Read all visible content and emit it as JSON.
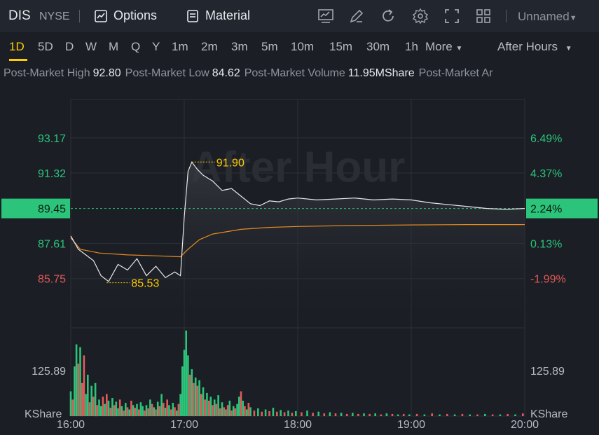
{
  "header": {
    "ticker": "DIS",
    "exchange": "NYSE",
    "options_label": "Options",
    "material_label": "Material",
    "layout_name": "Unnamed",
    "icons": [
      "chart-indicator-icon",
      "draw-icon",
      "refresh-icon",
      "settings-icon",
      "fullscreen-icon",
      "grid-layout-icon"
    ]
  },
  "periods": {
    "items": [
      "1D",
      "5D",
      "D",
      "W",
      "M",
      "Q",
      "Y",
      "1m",
      "2m",
      "3m",
      "5m",
      "10m",
      "15m",
      "30m",
      "1h"
    ],
    "more": "More",
    "active": "1D",
    "session": "After Hours"
  },
  "stats": [
    {
      "label": "Post-Market High",
      "value": "92.80"
    },
    {
      "label": "Post-Market Low",
      "value": "84.62"
    },
    {
      "label": "Post-Market Volume",
      "value": "11.95MShare"
    },
    {
      "label": "Post-Market Ar",
      "value": ""
    }
  ],
  "colors": {
    "up": "#2bc47a",
    "down": "#e25a5a",
    "price_line": "#e8e8e8",
    "avg_line": "#e68a1f",
    "accent": "#ffcc00",
    "current_bg": "#2bc47a"
  },
  "chart_data": {
    "type": "line",
    "watermark": "After Hour",
    "x_ticks": [
      "16:00",
      "17:00",
      "18:00",
      "19:00",
      "20:00"
    ],
    "y_left_ticks": [
      {
        "value": 93.17,
        "label": "93.17",
        "color": "up"
      },
      {
        "value": 91.32,
        "label": "91.32",
        "color": "up"
      },
      {
        "value": 87.61,
        "label": "87.61",
        "color": "up"
      },
      {
        "value": 85.75,
        "label": "85.75",
        "color": "down"
      }
    ],
    "y_right_ticks": [
      {
        "value": 93.17,
        "label": "6.49%",
        "color": "up"
      },
      {
        "value": 91.32,
        "label": "4.37%",
        "color": "up"
      },
      {
        "value": 87.61,
        "label": "0.13%",
        "color": "up"
      },
      {
        "value": 85.75,
        "label": "-1.99%",
        "color": "down"
      }
    ],
    "current": {
      "price": 89.45,
      "price_label": "89.45",
      "pct_label": "2.24%"
    },
    "ylim": [
      83.3,
      95.2
    ],
    "annotations": [
      {
        "time": "16:19",
        "value": 85.53,
        "label": "85.53"
      },
      {
        "time": "17:04",
        "value": 91.9,
        "label": "91.90"
      }
    ],
    "series": [
      {
        "role": "price",
        "times": [
          "16:00",
          "16:04",
          "16:08",
          "16:12",
          "16:16",
          "16:20",
          "16:25",
          "16:30",
          "16:35",
          "16:40",
          "16:45",
          "16:50",
          "16:55",
          "16:58",
          "17:00",
          "17:02",
          "17:04",
          "17:07",
          "17:10",
          "17:15",
          "17:20",
          "17:25",
          "17:30",
          "17:35",
          "17:40",
          "17:45",
          "17:50",
          "17:55",
          "18:00",
          "18:10",
          "18:20",
          "18:30",
          "18:40",
          "18:50",
          "19:00",
          "19:10",
          "19:20",
          "19:30",
          "19:40",
          "19:50",
          "20:00"
        ],
        "values": [
          88.0,
          87.3,
          87.0,
          86.7,
          85.9,
          85.6,
          86.5,
          86.2,
          86.8,
          85.9,
          86.4,
          85.8,
          86.1,
          85.9,
          89.0,
          91.4,
          91.9,
          91.5,
          91.2,
          90.9,
          90.4,
          90.5,
          90.1,
          89.7,
          89.6,
          89.85,
          89.8,
          89.95,
          90.0,
          89.9,
          89.95,
          90.0,
          89.9,
          89.95,
          89.9,
          89.75,
          89.65,
          89.55,
          89.45,
          89.4,
          89.45
        ]
      },
      {
        "role": "average",
        "times": [
          "16:00",
          "16:05",
          "16:15",
          "16:30",
          "16:45",
          "16:58",
          "17:02",
          "17:08",
          "17:15",
          "17:30",
          "17:45",
          "18:00",
          "18:30",
          "19:00",
          "19:30",
          "20:00"
        ],
        "values": [
          87.9,
          87.3,
          87.1,
          87.0,
          86.95,
          86.9,
          87.3,
          87.8,
          88.1,
          88.35,
          88.45,
          88.5,
          88.55,
          88.58,
          88.6,
          88.6
        ]
      }
    ],
    "volume": {
      "axis_label": "125.89",
      "unit": "KShare",
      "max": 160,
      "bars": [
        {
          "time": "16:00",
          "value": 45,
          "dir": "up"
        },
        {
          "time": "16:01",
          "value": 30,
          "dir": "down"
        },
        {
          "time": "16:02",
          "value": 90,
          "dir": "up"
        },
        {
          "time": "16:03",
          "value": 130,
          "dir": "up"
        },
        {
          "time": "16:04",
          "value": 95,
          "dir": "down"
        },
        {
          "time": "16:05",
          "value": 125,
          "dir": "up"
        },
        {
          "time": "16:06",
          "value": 60,
          "dir": "down"
        },
        {
          "time": "16:07",
          "value": 110,
          "dir": "down"
        },
        {
          "time": "16:08",
          "value": 40,
          "dir": "up"
        },
        {
          "time": "16:09",
          "value": 75,
          "dir": "up"
        },
        {
          "time": "16:10",
          "value": 25,
          "dir": "down"
        },
        {
          "time": "16:11",
          "value": 55,
          "dir": "up"
        },
        {
          "time": "16:12",
          "value": 35,
          "dir": "down"
        },
        {
          "time": "16:13",
          "value": 60,
          "dir": "up"
        },
        {
          "time": "16:14",
          "value": 20,
          "dir": "down"
        },
        {
          "time": "16:15",
          "value": 30,
          "dir": "up"
        },
        {
          "time": "16:16",
          "value": 18,
          "dir": "up"
        },
        {
          "time": "16:17",
          "value": 35,
          "dir": "down"
        },
        {
          "time": "16:18",
          "value": 22,
          "dir": "up"
        },
        {
          "time": "16:19",
          "value": 40,
          "dir": "down"
        },
        {
          "time": "16:20",
          "value": 28,
          "dir": "up"
        },
        {
          "time": "16:21",
          "value": 15,
          "dir": "down"
        },
        {
          "time": "16:22",
          "value": 33,
          "dir": "up"
        },
        {
          "time": "16:23",
          "value": 20,
          "dir": "down"
        },
        {
          "time": "16:24",
          "value": 26,
          "dir": "up"
        },
        {
          "time": "16:25",
          "value": 14,
          "dir": "up"
        },
        {
          "time": "16:26",
          "value": 30,
          "dir": "down"
        },
        {
          "time": "16:27",
          "value": 18,
          "dir": "up"
        },
        {
          "time": "16:28",
          "value": 10,
          "dir": "down"
        },
        {
          "time": "16:29",
          "value": 24,
          "dir": "up"
        },
        {
          "time": "16:30",
          "value": 16,
          "dir": "down"
        },
        {
          "time": "16:31",
          "value": 12,
          "dir": "up"
        },
        {
          "time": "16:32",
          "value": 28,
          "dir": "down"
        },
        {
          "time": "16:33",
          "value": 20,
          "dir": "up"
        },
        {
          "time": "16:34",
          "value": 15,
          "dir": "down"
        },
        {
          "time": "16:35",
          "value": 22,
          "dir": "up"
        },
        {
          "time": "16:36",
          "value": 12,
          "dir": "down"
        },
        {
          "time": "16:37",
          "value": 25,
          "dir": "up"
        },
        {
          "time": "16:38",
          "value": 18,
          "dir": "up"
        },
        {
          "time": "16:39",
          "value": 10,
          "dir": "down"
        },
        {
          "time": "16:40",
          "value": 20,
          "dir": "up"
        },
        {
          "time": "16:41",
          "value": 14,
          "dir": "down"
        },
        {
          "time": "16:42",
          "value": 30,
          "dir": "up"
        },
        {
          "time": "16:43",
          "value": 22,
          "dir": "down"
        },
        {
          "time": "16:44",
          "value": 16,
          "dir": "up"
        },
        {
          "time": "16:45",
          "value": 12,
          "dir": "down"
        },
        {
          "time": "16:46",
          "value": 26,
          "dir": "up"
        },
        {
          "time": "16:47",
          "value": 18,
          "dir": "down"
        },
        {
          "time": "16:48",
          "value": 40,
          "dir": "up"
        },
        {
          "time": "16:49",
          "value": 24,
          "dir": "down"
        },
        {
          "time": "16:50",
          "value": 15,
          "dir": "up"
        },
        {
          "time": "16:51",
          "value": 30,
          "dir": "down"
        },
        {
          "time": "16:52",
          "value": 20,
          "dir": "up"
        },
        {
          "time": "16:53",
          "value": 12,
          "dir": "down"
        },
        {
          "time": "16:54",
          "value": 24,
          "dir": "up"
        },
        {
          "time": "16:55",
          "value": 16,
          "dir": "down"
        },
        {
          "time": "16:56",
          "value": 10,
          "dir": "up"
        },
        {
          "time": "16:57",
          "value": 22,
          "dir": "down"
        },
        {
          "time": "16:58",
          "value": 40,
          "dir": "up"
        },
        {
          "time": "16:59",
          "value": 90,
          "dir": "up"
        },
        {
          "time": "17:00",
          "value": 120,
          "dir": "up"
        },
        {
          "time": "17:01",
          "value": 155,
          "dir": "up"
        },
        {
          "time": "17:02",
          "value": 110,
          "dir": "up"
        },
        {
          "time": "17:03",
          "value": 75,
          "dir": "down"
        },
        {
          "time": "17:04",
          "value": 85,
          "dir": "up"
        },
        {
          "time": "17:05",
          "value": 60,
          "dir": "down"
        },
        {
          "time": "17:06",
          "value": 70,
          "dir": "up"
        },
        {
          "time": "17:07",
          "value": 55,
          "dir": "down"
        },
        {
          "time": "17:08",
          "value": 65,
          "dir": "up"
        },
        {
          "time": "17:09",
          "value": 40,
          "dir": "down"
        },
        {
          "time": "17:10",
          "value": 52,
          "dir": "up"
        },
        {
          "time": "17:11",
          "value": 30,
          "dir": "down"
        },
        {
          "time": "17:12",
          "value": 42,
          "dir": "up"
        },
        {
          "time": "17:13",
          "value": 28,
          "dir": "down"
        },
        {
          "time": "17:14",
          "value": 35,
          "dir": "up"
        },
        {
          "time": "17:15",
          "value": 20,
          "dir": "down"
        },
        {
          "time": "17:16",
          "value": 30,
          "dir": "up"
        },
        {
          "time": "17:17",
          "value": 22,
          "dir": "down"
        },
        {
          "time": "17:18",
          "value": 38,
          "dir": "up"
        },
        {
          "time": "17:19",
          "value": 14,
          "dir": "down"
        },
        {
          "time": "17:20",
          "value": 25,
          "dir": "up"
        },
        {
          "time": "17:21",
          "value": 16,
          "dir": "down"
        },
        {
          "time": "17:22",
          "value": 12,
          "dir": "up"
        },
        {
          "time": "17:23",
          "value": 20,
          "dir": "down"
        },
        {
          "time": "17:24",
          "value": 28,
          "dir": "up"
        },
        {
          "time": "17:25",
          "value": 10,
          "dir": "down"
        },
        {
          "time": "17:26",
          "value": 18,
          "dir": "up"
        },
        {
          "time": "17:27",
          "value": 14,
          "dir": "down"
        },
        {
          "time": "17:28",
          "value": 22,
          "dir": "up"
        },
        {
          "time": "17:29",
          "value": 35,
          "dir": "up"
        },
        {
          "time": "17:30",
          "value": 45,
          "dir": "down"
        },
        {
          "time": "17:31",
          "value": 28,
          "dir": "up"
        },
        {
          "time": "17:32",
          "value": 18,
          "dir": "down"
        },
        {
          "time": "17:33",
          "value": 12,
          "dir": "up"
        },
        {
          "time": "17:34",
          "value": 24,
          "dir": "down"
        },
        {
          "time": "17:35",
          "value": 16,
          "dir": "up"
        },
        {
          "time": "17:37",
          "value": 10,
          "dir": "down"
        },
        {
          "time": "17:39",
          "value": 14,
          "dir": "up"
        },
        {
          "time": "17:41",
          "value": 8,
          "dir": "down"
        },
        {
          "time": "17:43",
          "value": 12,
          "dir": "up"
        },
        {
          "time": "17:45",
          "value": 9,
          "dir": "down"
        },
        {
          "time": "17:47",
          "value": 15,
          "dir": "up"
        },
        {
          "time": "17:49",
          "value": 8,
          "dir": "down"
        },
        {
          "time": "17:51",
          "value": 11,
          "dir": "up"
        },
        {
          "time": "17:53",
          "value": 7,
          "dir": "down"
        },
        {
          "time": "17:55",
          "value": 10,
          "dir": "up"
        },
        {
          "time": "17:57",
          "value": 6,
          "dir": "down"
        },
        {
          "time": "17:59",
          "value": 9,
          "dir": "up"
        },
        {
          "time": "18:02",
          "value": 7,
          "dir": "down"
        },
        {
          "time": "18:05",
          "value": 10,
          "dir": "up"
        },
        {
          "time": "18:08",
          "value": 6,
          "dir": "down"
        },
        {
          "time": "18:11",
          "value": 8,
          "dir": "up"
        },
        {
          "time": "18:14",
          "value": 5,
          "dir": "down"
        },
        {
          "time": "18:17",
          "value": 7,
          "dir": "up"
        },
        {
          "time": "18:20",
          "value": 5,
          "dir": "down"
        },
        {
          "time": "18:23",
          "value": 6,
          "dir": "up"
        },
        {
          "time": "18:26",
          "value": 4,
          "dir": "down"
        },
        {
          "time": "18:29",
          "value": 6,
          "dir": "up"
        },
        {
          "time": "18:32",
          "value": 4,
          "dir": "down"
        },
        {
          "time": "18:35",
          "value": 5,
          "dir": "up"
        },
        {
          "time": "18:38",
          "value": 4,
          "dir": "down"
        },
        {
          "time": "18:41",
          "value": 5,
          "dir": "up"
        },
        {
          "time": "18:44",
          "value": 3,
          "dir": "down"
        },
        {
          "time": "18:47",
          "value": 5,
          "dir": "up"
        },
        {
          "time": "18:50",
          "value": 4,
          "dir": "down"
        },
        {
          "time": "18:53",
          "value": 3,
          "dir": "up"
        },
        {
          "time": "18:56",
          "value": 4,
          "dir": "down"
        },
        {
          "time": "18:59",
          "value": 3,
          "dir": "up"
        },
        {
          "time": "19:03",
          "value": 4,
          "dir": "down"
        },
        {
          "time": "19:07",
          "value": 3,
          "dir": "up"
        },
        {
          "time": "19:11",
          "value": 5,
          "dir": "down"
        },
        {
          "time": "19:15",
          "value": 3,
          "dir": "up"
        },
        {
          "time": "19:19",
          "value": 4,
          "dir": "down"
        },
        {
          "time": "19:23",
          "value": 3,
          "dir": "up"
        },
        {
          "time": "19:27",
          "value": 4,
          "dir": "down"
        },
        {
          "time": "19:31",
          "value": 3,
          "dir": "up"
        },
        {
          "time": "19:35",
          "value": 3,
          "dir": "down"
        },
        {
          "time": "19:39",
          "value": 4,
          "dir": "up"
        },
        {
          "time": "19:43",
          "value": 3,
          "dir": "down"
        },
        {
          "time": "19:47",
          "value": 3,
          "dir": "up"
        },
        {
          "time": "19:51",
          "value": 4,
          "dir": "down"
        },
        {
          "time": "19:55",
          "value": 3,
          "dir": "up"
        },
        {
          "time": "19:59",
          "value": 5,
          "dir": "down"
        }
      ]
    }
  }
}
